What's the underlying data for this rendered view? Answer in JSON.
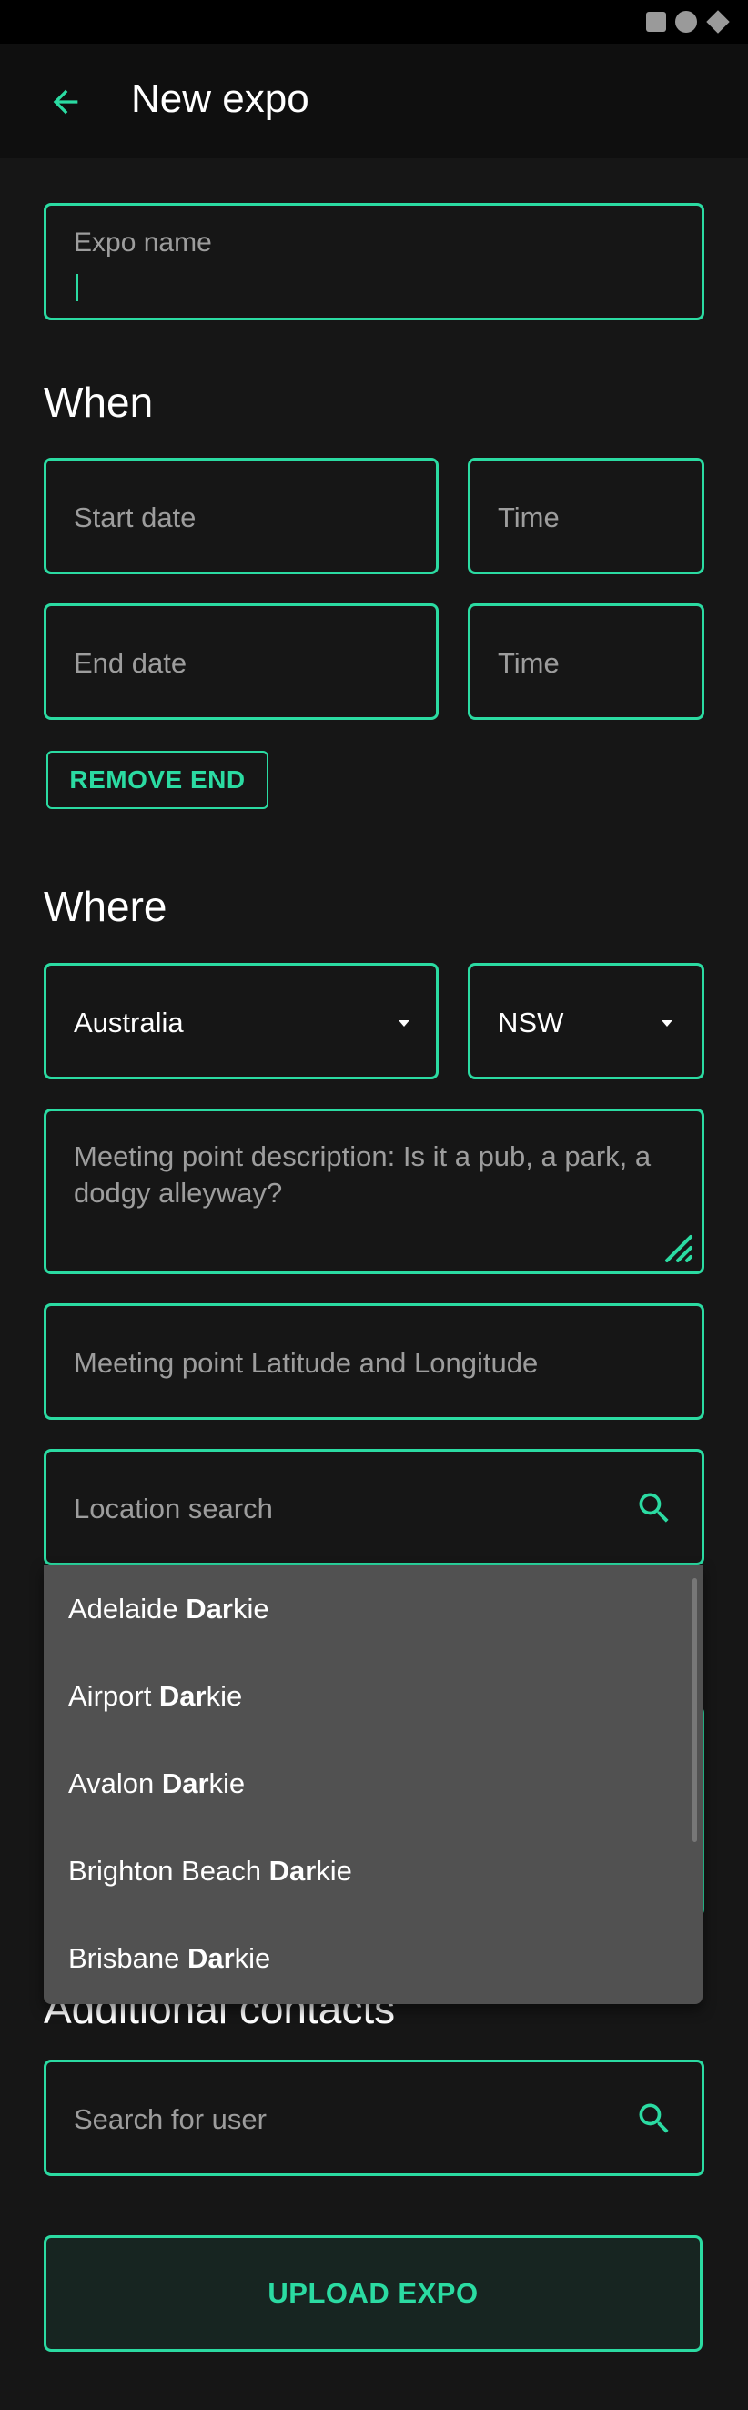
{
  "appbar": {
    "title": "New expo",
    "back_icon": "arrow-left-icon"
  },
  "form": {
    "expo_name": {
      "placeholder": "Expo name",
      "value": ""
    },
    "when": {
      "title": "When",
      "start_date": {
        "placeholder": "Start date"
      },
      "start_time": {
        "placeholder": "Time"
      },
      "end_date": {
        "placeholder": "End date"
      },
      "end_time": {
        "placeholder": "Time"
      },
      "remove_end_label": "REMOVE END"
    },
    "where": {
      "title": "Where",
      "country": {
        "value": "Australia"
      },
      "state": {
        "value": "NSW"
      },
      "meeting_description": {
        "placeholder": "Meeting point description: Is it a pub, a park, a dodgy alleyway?"
      },
      "lat_long": {
        "placeholder": "Meeting point Latitude and Longitude"
      },
      "location_search": {
        "placeholder": "Location search"
      }
    },
    "additional_contacts": {
      "title": "Additional contacts",
      "user_search": {
        "placeholder": "Search for user"
      }
    },
    "upload_label": "UPLOAD EXPO"
  },
  "location_suggestions": [
    {
      "prefix": "Adelaide ",
      "match": "Dar",
      "suffix": "kie"
    },
    {
      "prefix": "Airport ",
      "match": "Dar",
      "suffix": "kie"
    },
    {
      "prefix": "Avalon ",
      "match": "Dar",
      "suffix": "kie"
    },
    {
      "prefix": "Brighton Beach ",
      "match": "Dar",
      "suffix": "kie"
    },
    {
      "prefix": "Brisbane ",
      "match": "Dar",
      "suffix": "kie"
    }
  ],
  "colors": {
    "accent": "#2bdba2",
    "background": "#161616",
    "appbar": "#0f0f0f",
    "dropdown": "#515151"
  }
}
